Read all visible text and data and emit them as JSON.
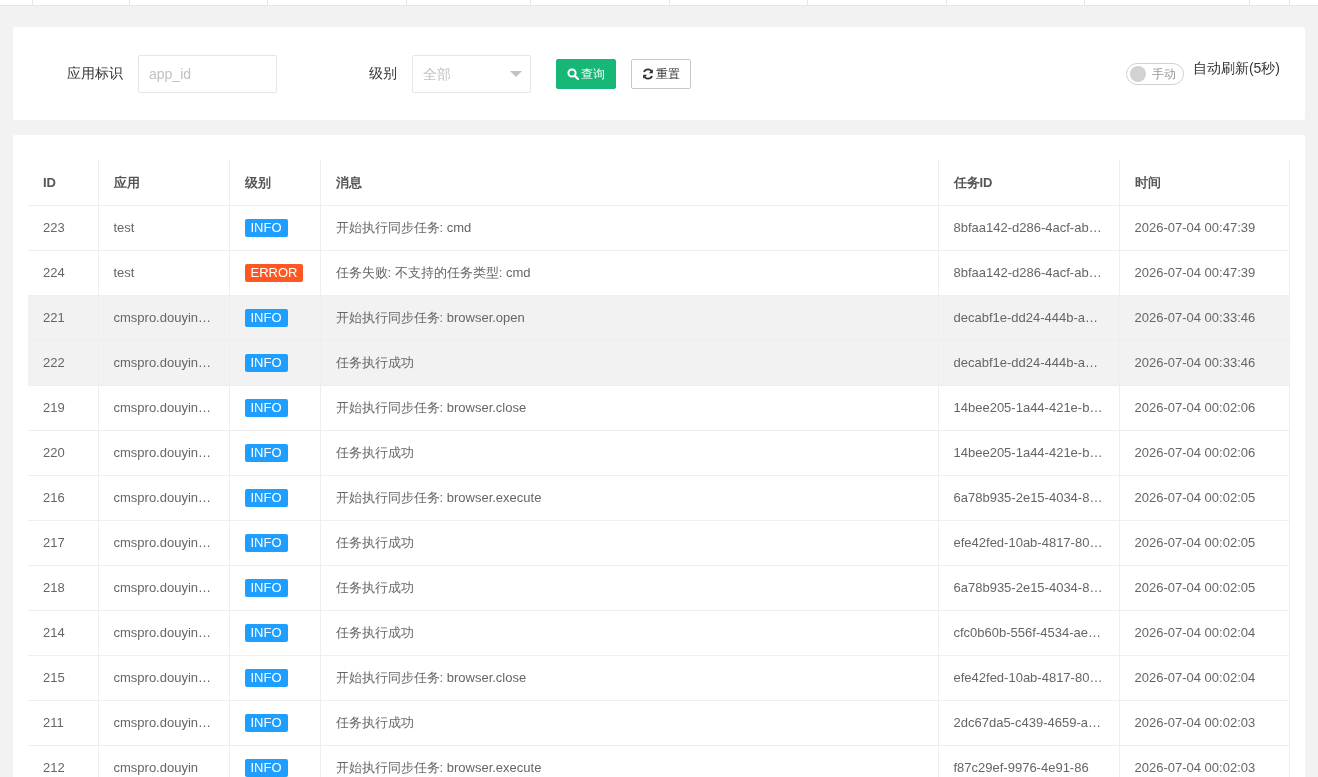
{
  "filter": {
    "fields": [
      {
        "kind": "input",
        "label": "应用标识",
        "placeholder": "app_id"
      },
      {
        "kind": "select",
        "label": "级别",
        "placeholder": "全部"
      }
    ],
    "buttons": [
      {
        "kind": "search",
        "label": "查询"
      },
      {
        "kind": "reset",
        "label": "重置"
      }
    ],
    "auto_refresh": {
      "on": false,
      "switch_text": "手动",
      "label": "自动刷新(5秒)"
    }
  },
  "table": {
    "columns": [
      "ID",
      "应用",
      "级别",
      "消息",
      "任务ID",
      "时间"
    ],
    "rows": [
      {
        "id": "223",
        "app": "test",
        "level": {
          "text": "INFO",
          "color": "#1e9fff"
        },
        "message": "开始执行同步任务: cmd",
        "task_id": "8bfaa142-d286-4acf-ab…",
        "time": "2026-07-04 00:47:39",
        "highlighted": false
      },
      {
        "id": "224",
        "app": "test",
        "level": {
          "text": "ERROR",
          "color": "#ff5722"
        },
        "message": "任务失败: 不支持的任务类型: cmd",
        "task_id": "8bfaa142-d286-4acf-ab…",
        "time": "2026-07-04 00:47:39",
        "highlighted": false
      },
      {
        "id": "221",
        "app": "cmspro.douyin…",
        "level": {
          "text": "INFO",
          "color": "#1e9fff"
        },
        "message": "开始执行同步任务: browser.open",
        "task_id": "decabf1e-dd24-444b-a…",
        "time": "2026-07-04 00:33:46",
        "highlighted": true
      },
      {
        "id": "222",
        "app": "cmspro.douyin…",
        "level": {
          "text": "INFO",
          "color": "#1e9fff"
        },
        "message": "任务执行成功",
        "task_id": "decabf1e-dd24-444b-a…",
        "time": "2026-07-04 00:33:46",
        "highlighted": true
      },
      {
        "id": "219",
        "app": "cmspro.douyin…",
        "level": {
          "text": "INFO",
          "color": "#1e9fff"
        },
        "message": "开始执行同步任务: browser.close",
        "task_id": "14bee205-1a44-421e-b…",
        "time": "2026-07-04 00:02:06",
        "highlighted": false
      },
      {
        "id": "220",
        "app": "cmspro.douyin…",
        "level": {
          "text": "INFO",
          "color": "#1e9fff"
        },
        "message": "任务执行成功",
        "task_id": "14bee205-1a44-421e-b…",
        "time": "2026-07-04 00:02:06",
        "highlighted": false
      },
      {
        "id": "216",
        "app": "cmspro.douyin…",
        "level": {
          "text": "INFO",
          "color": "#1e9fff"
        },
        "message": "开始执行同步任务: browser.execute",
        "task_id": "6a78b935-2e15-4034-8…",
        "time": "2026-07-04 00:02:05",
        "highlighted": false
      },
      {
        "id": "217",
        "app": "cmspro.douyin…",
        "level": {
          "text": "INFO",
          "color": "#1e9fff"
        },
        "message": "任务执行成功",
        "task_id": "efe42fed-10ab-4817-80…",
        "time": "2026-07-04 00:02:05",
        "highlighted": false
      },
      {
        "id": "218",
        "app": "cmspro.douyin…",
        "level": {
          "text": "INFO",
          "color": "#1e9fff"
        },
        "message": "任务执行成功",
        "task_id": "6a78b935-2e15-4034-8…",
        "time": "2026-07-04 00:02:05",
        "highlighted": false
      },
      {
        "id": "214",
        "app": "cmspro.douyin…",
        "level": {
          "text": "INFO",
          "color": "#1e9fff"
        },
        "message": "任务执行成功",
        "task_id": "cfc0b60b-556f-4534-ae…",
        "time": "2026-07-04 00:02:04",
        "highlighted": false
      },
      {
        "id": "215",
        "app": "cmspro.douyin…",
        "level": {
          "text": "INFO",
          "color": "#1e9fff"
        },
        "message": "开始执行同步任务: browser.close",
        "task_id": "efe42fed-10ab-4817-80…",
        "time": "2026-07-04 00:02:04",
        "highlighted": false
      },
      {
        "id": "211",
        "app": "cmspro.douyin…",
        "level": {
          "text": "INFO",
          "color": "#1e9fff"
        },
        "message": "任务执行成功",
        "task_id": "2dc67da5-c439-4659-a…",
        "time": "2026-07-04 00:02:03",
        "highlighted": false
      },
      {
        "id": "212",
        "app": "cmspro.douyin",
        "level": {
          "text": "INFO",
          "color": "#1e9fff"
        },
        "message": "开始执行同步任务: browser.execute",
        "task_id": "f87c29ef-9976-4e91-86",
        "time": "2026-07-04 00:02:03",
        "highlighted": false
      }
    ]
  }
}
